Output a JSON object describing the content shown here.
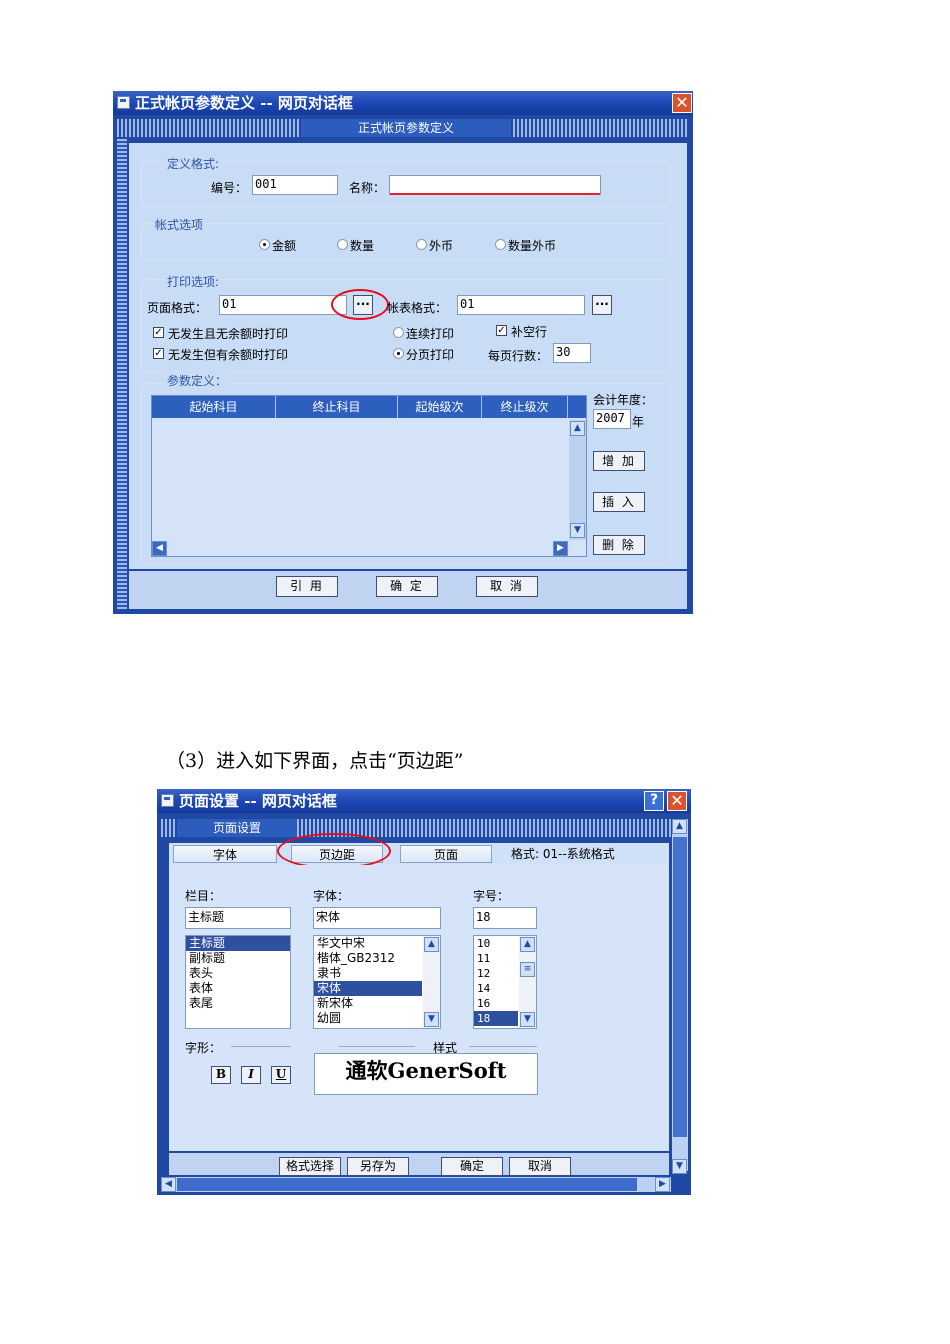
{
  "dialog1": {
    "title": "正式帐页参数定义 -- 网页对话框",
    "close_glyph": "✕",
    "header": "正式帐页参数定义",
    "define_format": {
      "legend": "定义格式:",
      "code_label": "编号：",
      "code_value": "001",
      "name_label": "名称：",
      "name_value": ""
    },
    "account_options": {
      "legend": "帐式选项",
      "radios": [
        {
          "label": "金额",
          "selected": true
        },
        {
          "label": "数量",
          "selected": false
        },
        {
          "label": "外币",
          "selected": false
        },
        {
          "label": "数量外币",
          "selected": false
        }
      ]
    },
    "print_options": {
      "legend": "打印选项:",
      "page_format_label": "页面格式：",
      "page_format_value": "01",
      "table_format_label": "帐表格式：",
      "table_format_value": "01",
      "ellipsis": "···",
      "check1": "无发生且无余额时打印",
      "check2": "无发生但有余额时打印",
      "radio_continuous": "连续打印",
      "radio_paged": "分页打印",
      "check_fill": "补空行",
      "rows_label": "每页行数：",
      "rows_value": "30",
      "check_mark": "✓"
    },
    "params": {
      "legend": "参数定义：",
      "columns": [
        "起始科目",
        "终止科目",
        "起始级次",
        "终止级次"
      ],
      "fiscal_year_label": "会计年度：",
      "fiscal_year_value": "2007",
      "year_suffix": "年",
      "add": "增 加",
      "insert": "插 入",
      "delete": "删 除"
    },
    "footer": {
      "cite": "引 用",
      "ok": "确 定",
      "cancel": "取 消"
    }
  },
  "caption": "（3）进入如下界面，点击“页边距”",
  "dialog2": {
    "title": "页面设置 -- 网页对话框",
    "help_glyph": "?",
    "close_glyph": "✕",
    "header": "页面设置",
    "tabs": [
      "字体",
      "页边距",
      "页面"
    ],
    "format_label": "格式: 01--系统格式",
    "column_label": "栏目：",
    "column_value": "主标题",
    "column_items": [
      "主标题",
      "副标题",
      "表头",
      "表体",
      "表尾"
    ],
    "font_label": "字体：",
    "font_value": "宋体",
    "font_items": [
      "华文中宋",
      "楷体_GB2312",
      "隶书",
      "宋体",
      "新宋体",
      "幼圆"
    ],
    "size_label": "字号：",
    "size_value": "18",
    "size_items": [
      "10",
      "11",
      "12",
      "14",
      "16",
      "18"
    ],
    "style_label": "字形：",
    "preview_label": "样式",
    "style_buttons": [
      "B",
      "I",
      "U"
    ],
    "preview_text": "通软GenerSoft",
    "footer": {
      "format_select": "格式选择",
      "save_as": "另存为",
      "ok": "确定",
      "cancel": "取消"
    }
  }
}
